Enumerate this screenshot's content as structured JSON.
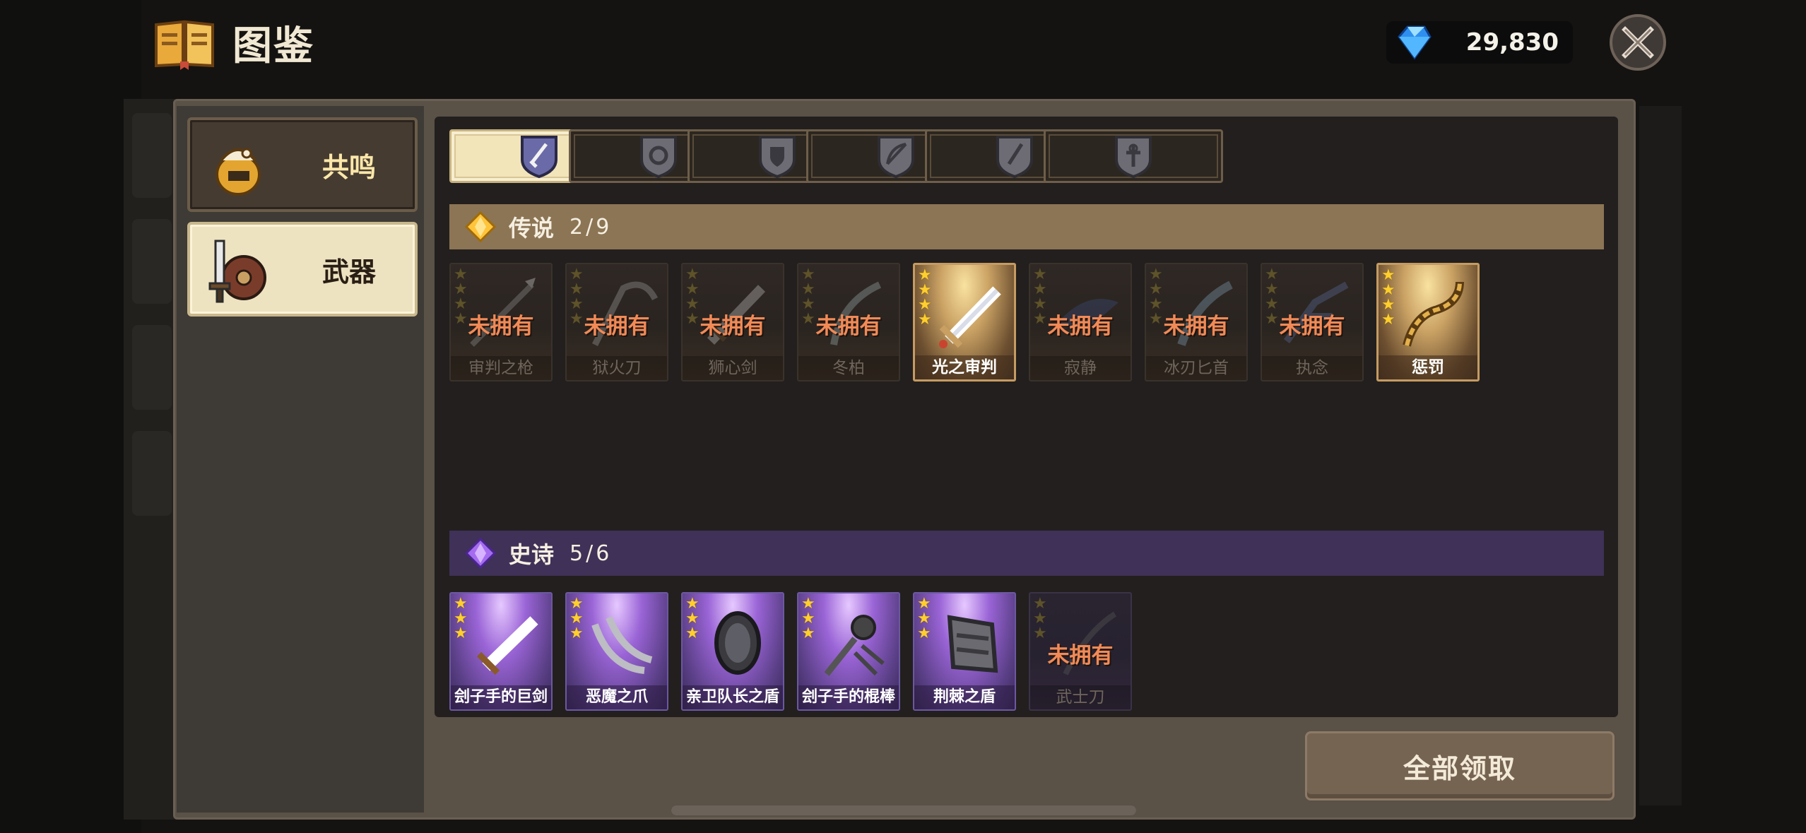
{
  "header": {
    "title": "图鉴",
    "currency_value": "29,830"
  },
  "menu": [
    {
      "label": "共鸣",
      "active": false
    },
    {
      "label": "武器",
      "active": true
    }
  ],
  "tabs": [
    {
      "icon": "sword-category-icon",
      "active": true
    },
    {
      "icon": "ring-category-icon",
      "active": false
    },
    {
      "icon": "shield-category-icon",
      "active": false
    },
    {
      "icon": "bow-category-icon",
      "active": false
    },
    {
      "icon": "dagger-category-icon",
      "active": false
    },
    {
      "icon": "staff-category-icon",
      "active": false
    }
  ],
  "legend_section": {
    "title": "传说",
    "count": "2/9",
    "items": [
      {
        "name": "审判之枪",
        "owned": false,
        "status": "未拥有",
        "icon": "spear-icon"
      },
      {
        "name": "狱火刀",
        "owned": false,
        "status": "未拥有",
        "icon": "scythe-icon"
      },
      {
        "name": "狮心剑",
        "owned": false,
        "status": "未拥有",
        "icon": "greatsword-icon"
      },
      {
        "name": "冬柏",
        "owned": false,
        "status": "未拥有",
        "icon": "curved-blade-icon"
      },
      {
        "name": "光之审判",
        "owned": true,
        "status": "",
        "icon": "holy-sword-icon"
      },
      {
        "name": "寂静",
        "owned": false,
        "status": "未拥有",
        "icon": "dark-blade-icon"
      },
      {
        "name": "冰刃匕首",
        "owned": false,
        "status": "未拥有",
        "icon": "ice-dagger-icon"
      },
      {
        "name": "执念",
        "owned": false,
        "status": "未拥有",
        "icon": "claw-icon"
      },
      {
        "name": "惩罚",
        "owned": true,
        "status": "",
        "icon": "chain-icon"
      }
    ]
  },
  "epic_section": {
    "title": "史诗",
    "count": "5/6",
    "items": [
      {
        "name": "刽子手的巨剑",
        "owned": true,
        "status": "",
        "icon": "executioner-sword-icon"
      },
      {
        "name": "恶魔之爪",
        "owned": true,
        "status": "",
        "icon": "demon-claw-icon"
      },
      {
        "name": "亲卫队长之盾",
        "owned": true,
        "status": "",
        "icon": "captain-shield-icon"
      },
      {
        "name": "刽子手的棍棒",
        "owned": true,
        "status": "",
        "icon": "flail-icon"
      },
      {
        "name": "荆棘之盾",
        "owned": true,
        "status": "",
        "icon": "thorn-shield-icon"
      },
      {
        "name": "武士刀",
        "owned": false,
        "status": "未拥有",
        "icon": "katana-icon"
      }
    ]
  },
  "claim_button": "全部领取",
  "colors": {
    "legend_header": "#8c7555",
    "epic_header": "#3f3157",
    "locked_text": "#f28a56",
    "star": "#ffcf2d"
  }
}
